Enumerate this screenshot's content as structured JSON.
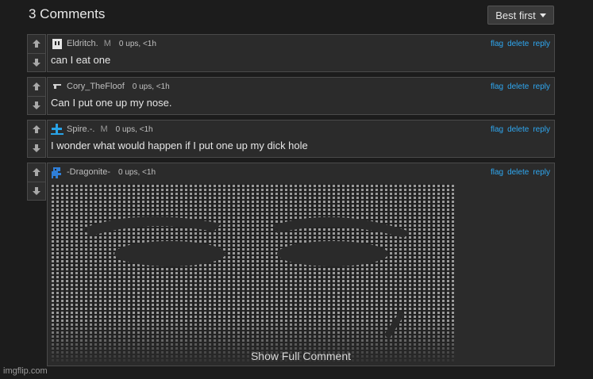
{
  "header": {
    "title": "3 Comments",
    "sort_label": "Best first"
  },
  "comments": [
    {
      "user": "Eldritch.",
      "gender": "M",
      "stats": "0 ups, <1h",
      "text": "can I eat one",
      "avatar_icon": "skull-icon",
      "avatar_color": "#e6e6e6"
    },
    {
      "user": "Cory_TheFloof",
      "gender": "",
      "stats": "0 ups, <1h",
      "text": "Can I put one up my nose.",
      "avatar_icon": "gun-icon",
      "avatar_color": "#d0d0d0"
    },
    {
      "user": "Spire.-.",
      "gender": "M",
      "stats": "0 ups, <1h",
      "text": "I wonder what would happen if I put one up my dick hole",
      "avatar_icon": "cross-icon",
      "avatar_color": "#29a3e6"
    },
    {
      "user": "-Dragonite-",
      "gender": "",
      "stats": "0 ups, <1h",
      "text": "",
      "avatar_icon": "dino-icon",
      "avatar_color": "#2f7fd8",
      "show_full": "Show Full Comment"
    }
  ],
  "actions": {
    "flag": "flag",
    "delete": "delete",
    "reply": "reply"
  },
  "watermark": "imgflip.com",
  "colors": {
    "link": "#2fa7f0",
    "background": "#1c1c1c",
    "panel": "#2b2b2b"
  }
}
